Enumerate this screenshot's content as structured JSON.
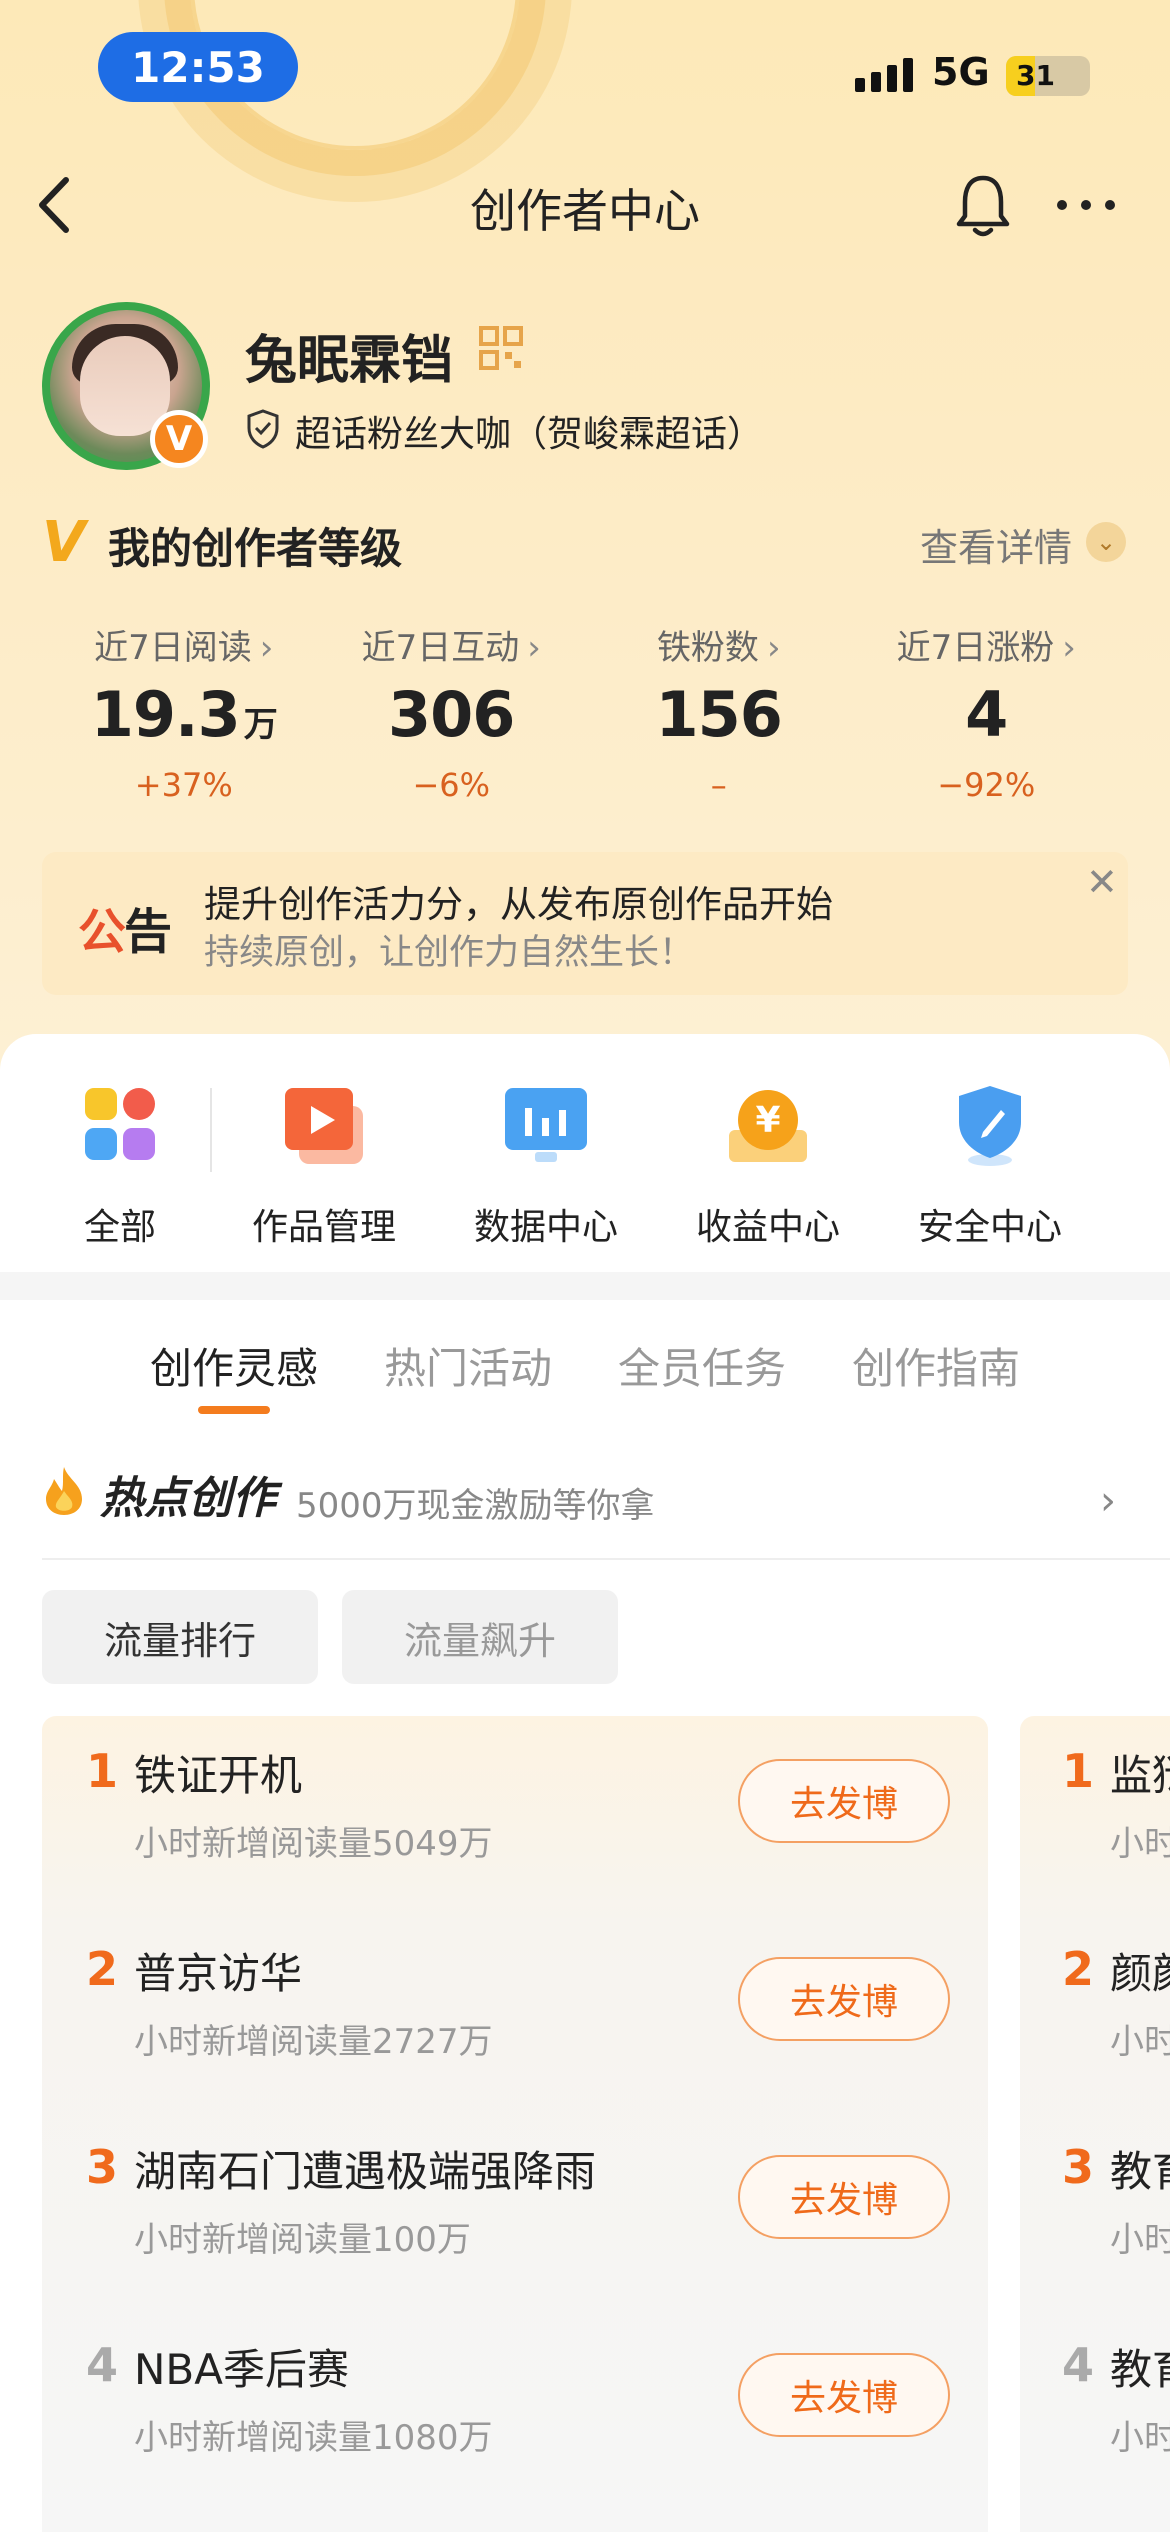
{
  "status": {
    "time": "12:53",
    "network": "5G",
    "battery": "31"
  },
  "nav": {
    "title": "创作者中心"
  },
  "profile": {
    "username": "兔眠霖铛",
    "fan_tag": "超话粉丝大咖（贺峻霖超话）",
    "badge": "V"
  },
  "level": {
    "badge": "V",
    "title": "我的创作者等级",
    "detail_link": "查看详情"
  },
  "stats": [
    {
      "label": "近7日阅读",
      "value": "19.3",
      "unit": "万",
      "change": "+37%"
    },
    {
      "label": "近7日互动",
      "value": "306",
      "unit": "",
      "change": "−6%"
    },
    {
      "label": "铁粉数",
      "value": "156",
      "unit": "",
      "change": "–"
    },
    {
      "label": "近7日涨粉",
      "value": "4",
      "unit": "",
      "change": "−92%"
    }
  ],
  "notice": {
    "tag_a": "公",
    "tag_b": "告",
    "line1": "提升创作活力分，从发布原创作品开始",
    "line2": "持续原创，让创作力自然生长！"
  },
  "shortcuts": [
    {
      "label": "全部",
      "icon": "grid-apps-icon"
    },
    {
      "label": "作品管理",
      "icon": "video-play-icon"
    },
    {
      "label": "数据中心",
      "icon": "bar-chart-icon"
    },
    {
      "label": "收益中心",
      "icon": "yuan-coin-icon"
    },
    {
      "label": "安全中心",
      "icon": "shield-pen-icon"
    }
  ],
  "tabs": [
    "创作灵感",
    "热门活动",
    "全员任务",
    "创作指南"
  ],
  "hot": {
    "title": "热点创作",
    "subtitle": "5000万现金激励等你拿"
  },
  "filters": [
    "流量排行",
    "流量飙升"
  ],
  "ranking": [
    {
      "rank": "1",
      "title": "铁证开机",
      "meta": "小时新增阅读量5049万",
      "action": "去发博"
    },
    {
      "rank": "2",
      "title": "普京访华",
      "meta": "小时新增阅读量2727万",
      "action": "去发博"
    },
    {
      "rank": "3",
      "title": "湖南石门遭遇极端强降雨",
      "meta": "小时新增阅读量100万",
      "action": "去发博"
    },
    {
      "rank": "4",
      "title": "NBA季后赛",
      "meta": "小时新增阅读量1080万",
      "action": "去发博"
    }
  ],
  "ranking2": [
    {
      "rank": "1",
      "title": "监狱",
      "meta": "小时"
    },
    {
      "rank": "2",
      "title": "颜颜",
      "meta": "小时"
    },
    {
      "rank": "3",
      "title": "教育",
      "meta": "小时"
    },
    {
      "rank": "4",
      "title": "教育",
      "meta": "小时"
    }
  ],
  "colors": {
    "accent": "#f47c1e",
    "time_pill": "#1e6de5",
    "notice_red": "#e8512c"
  }
}
